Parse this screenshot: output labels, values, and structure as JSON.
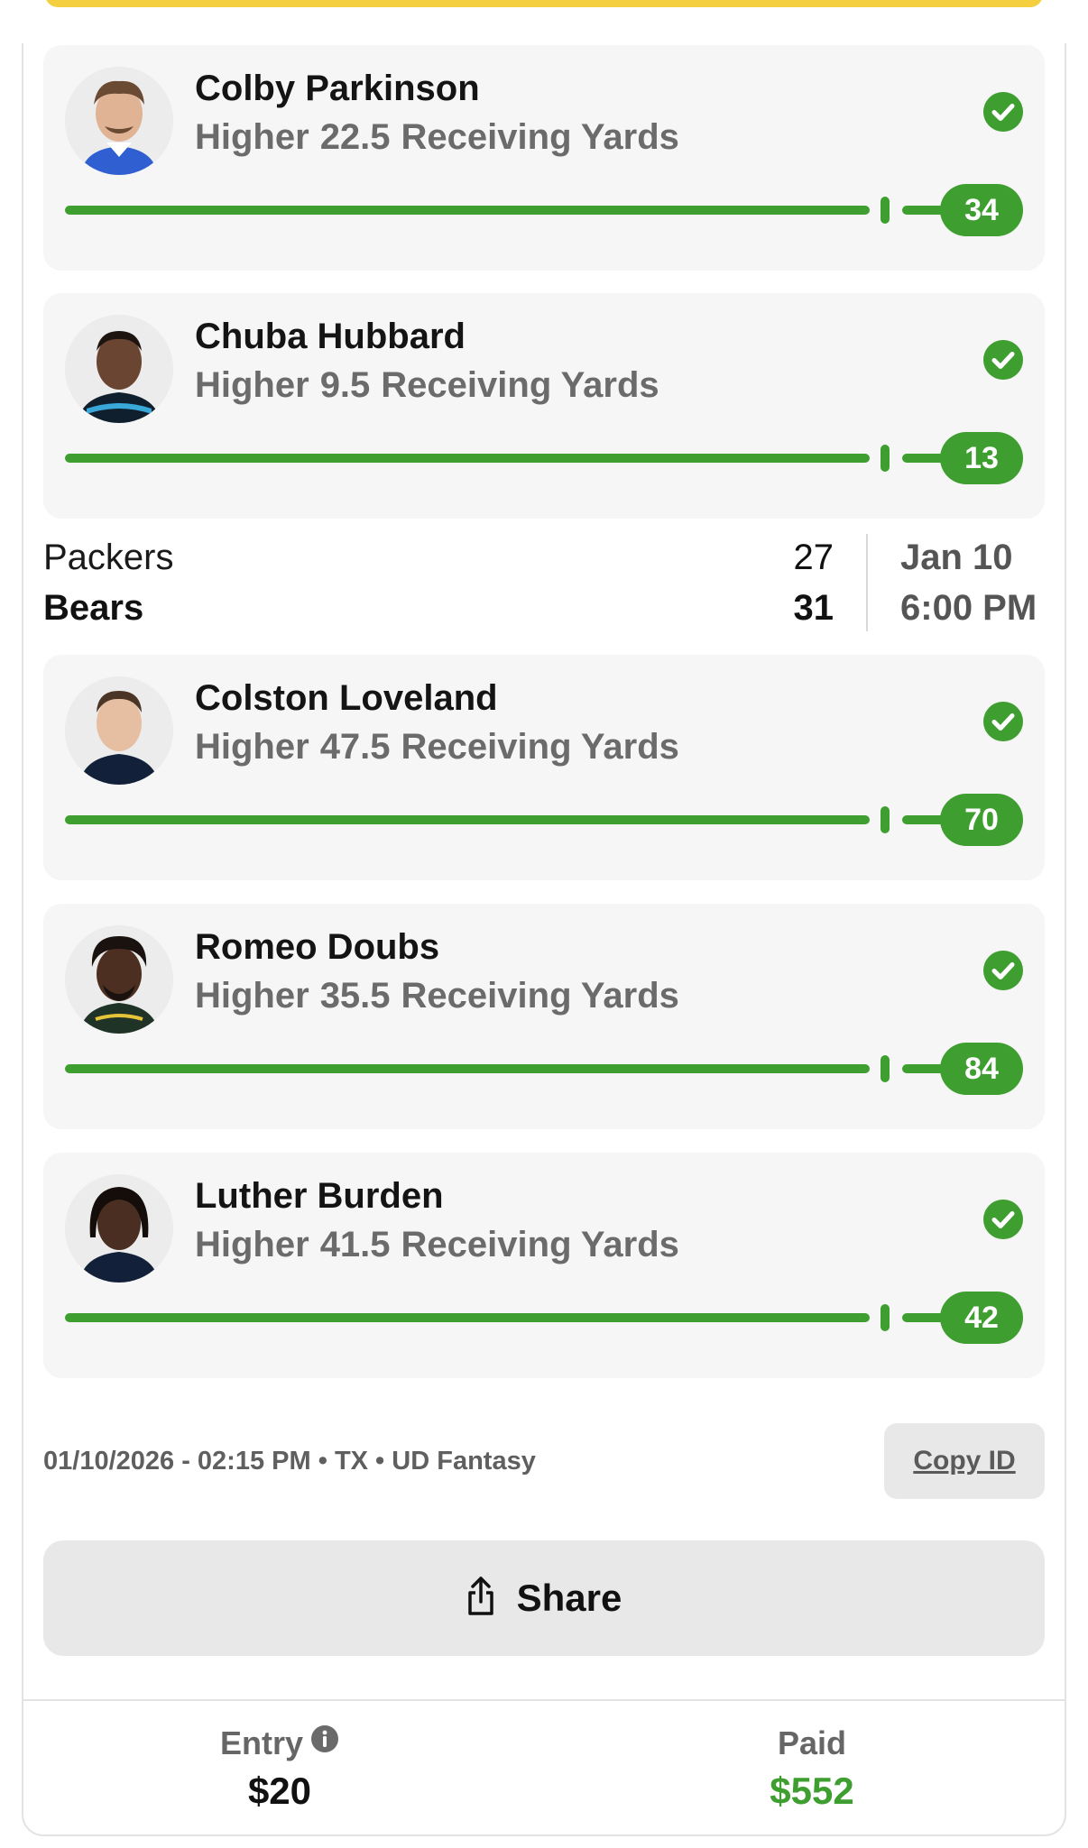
{
  "colors": {
    "success_green": "#3e9e2f",
    "accent_yellow": "#f4cf3f",
    "card_bg": "#f6f6f6"
  },
  "picks_group_1": [
    {
      "player": "Colby Parkinson",
      "direction": "Higher",
      "line": "22.5",
      "stat": "Receiving Yards",
      "result": "34",
      "status_icon": "check-circle-icon"
    },
    {
      "player": "Chuba Hubbard",
      "direction": "Higher",
      "line": "9.5",
      "stat": "Receiving Yards",
      "result": "13",
      "status_icon": "check-circle-icon"
    }
  ],
  "game": {
    "away_team": "Packers",
    "away_score": "27",
    "home_team": "Bears",
    "home_score": "31",
    "date": "Jan 10",
    "time": "6:00 PM"
  },
  "picks_group_2": [
    {
      "player": "Colston Loveland",
      "direction": "Higher",
      "line": "47.5",
      "stat": "Receiving Yards",
      "result": "70",
      "status_icon": "check-circle-icon"
    },
    {
      "player": "Romeo Doubs",
      "direction": "Higher",
      "line": "35.5",
      "stat": "Receiving Yards",
      "result": "84",
      "status_icon": "check-circle-icon"
    },
    {
      "player": "Luther Burden",
      "direction": "Higher",
      "line": "41.5",
      "stat": "Receiving Yards",
      "result": "42",
      "status_icon": "check-circle-icon"
    }
  ],
  "meta": {
    "timestamp": "01/10/2026 - 02:15 PM",
    "sep": " • ",
    "state": "TX",
    "product": "UD Fantasy",
    "copy_label": "Copy ID"
  },
  "share": {
    "label": "Share",
    "icon": "share-icon"
  },
  "footer": {
    "entry_label": "Entry",
    "entry_value": "$20",
    "entry_icon": "info-icon",
    "paid_label": "Paid",
    "paid_value": "$552"
  }
}
